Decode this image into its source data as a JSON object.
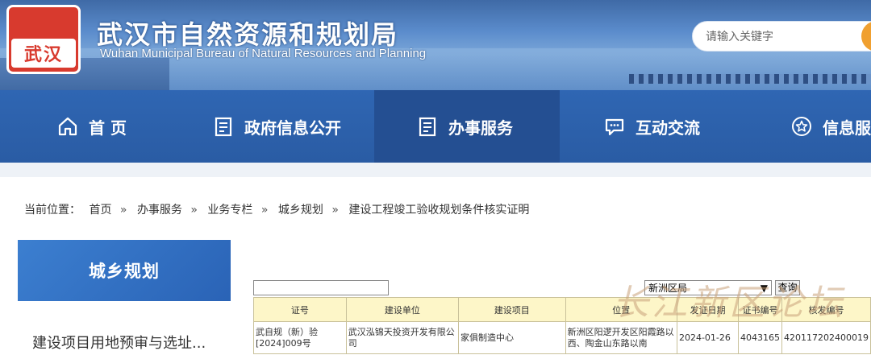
{
  "header": {
    "logo_text": "武汉",
    "title": "武汉市自然资源和规划局",
    "subtitle": "Wuhan Municipal Bureau of Natural Resources and Planning",
    "search_placeholder": "请输入关键字"
  },
  "nav": {
    "items": [
      {
        "label": "首 页",
        "icon": "home-icon"
      },
      {
        "label": "政府信息公开",
        "icon": "document-icon"
      },
      {
        "label": "办事服务",
        "icon": "document-icon"
      },
      {
        "label": "互动交流",
        "icon": "chat-icon"
      },
      {
        "label": "信息服",
        "icon": "star-icon"
      }
    ]
  },
  "breadcrumb": {
    "prefix": "当前位置：",
    "items": [
      "首页",
      "办事服务",
      "业务专栏",
      "城乡规划",
      "建设工程竣工验收规划条件核实证明"
    ],
    "separator": "»"
  },
  "sidebar": {
    "heading": "城乡规划",
    "items": [
      "建设项目用地预审与选址..."
    ]
  },
  "filter": {
    "text_value": "",
    "district_selected": "新洲区局",
    "query_label": "查询"
  },
  "table": {
    "columns": [
      "证号",
      "建设单位",
      "建设项目",
      "位置",
      "发证日期",
      "证书编号",
      "核发编号"
    ],
    "rows": [
      [
        "武自规（新）验[2024]009号",
        "武汉泓锦天投资开发有限公司",
        "家俱制造中心",
        "新洲区阳逻开发区阳霞路以西、陶金山东路以南",
        "2024-01-26",
        "4043165",
        "420117202400019"
      ]
    ]
  },
  "watermark": "长江新区论坛",
  "colors": {
    "nav_bg": "#2f66b3",
    "nav_active": "#244f92",
    "sidebar_head": "#2a63b6",
    "table_head": "#fdf6c8",
    "logo_red": "#d83a2e"
  }
}
